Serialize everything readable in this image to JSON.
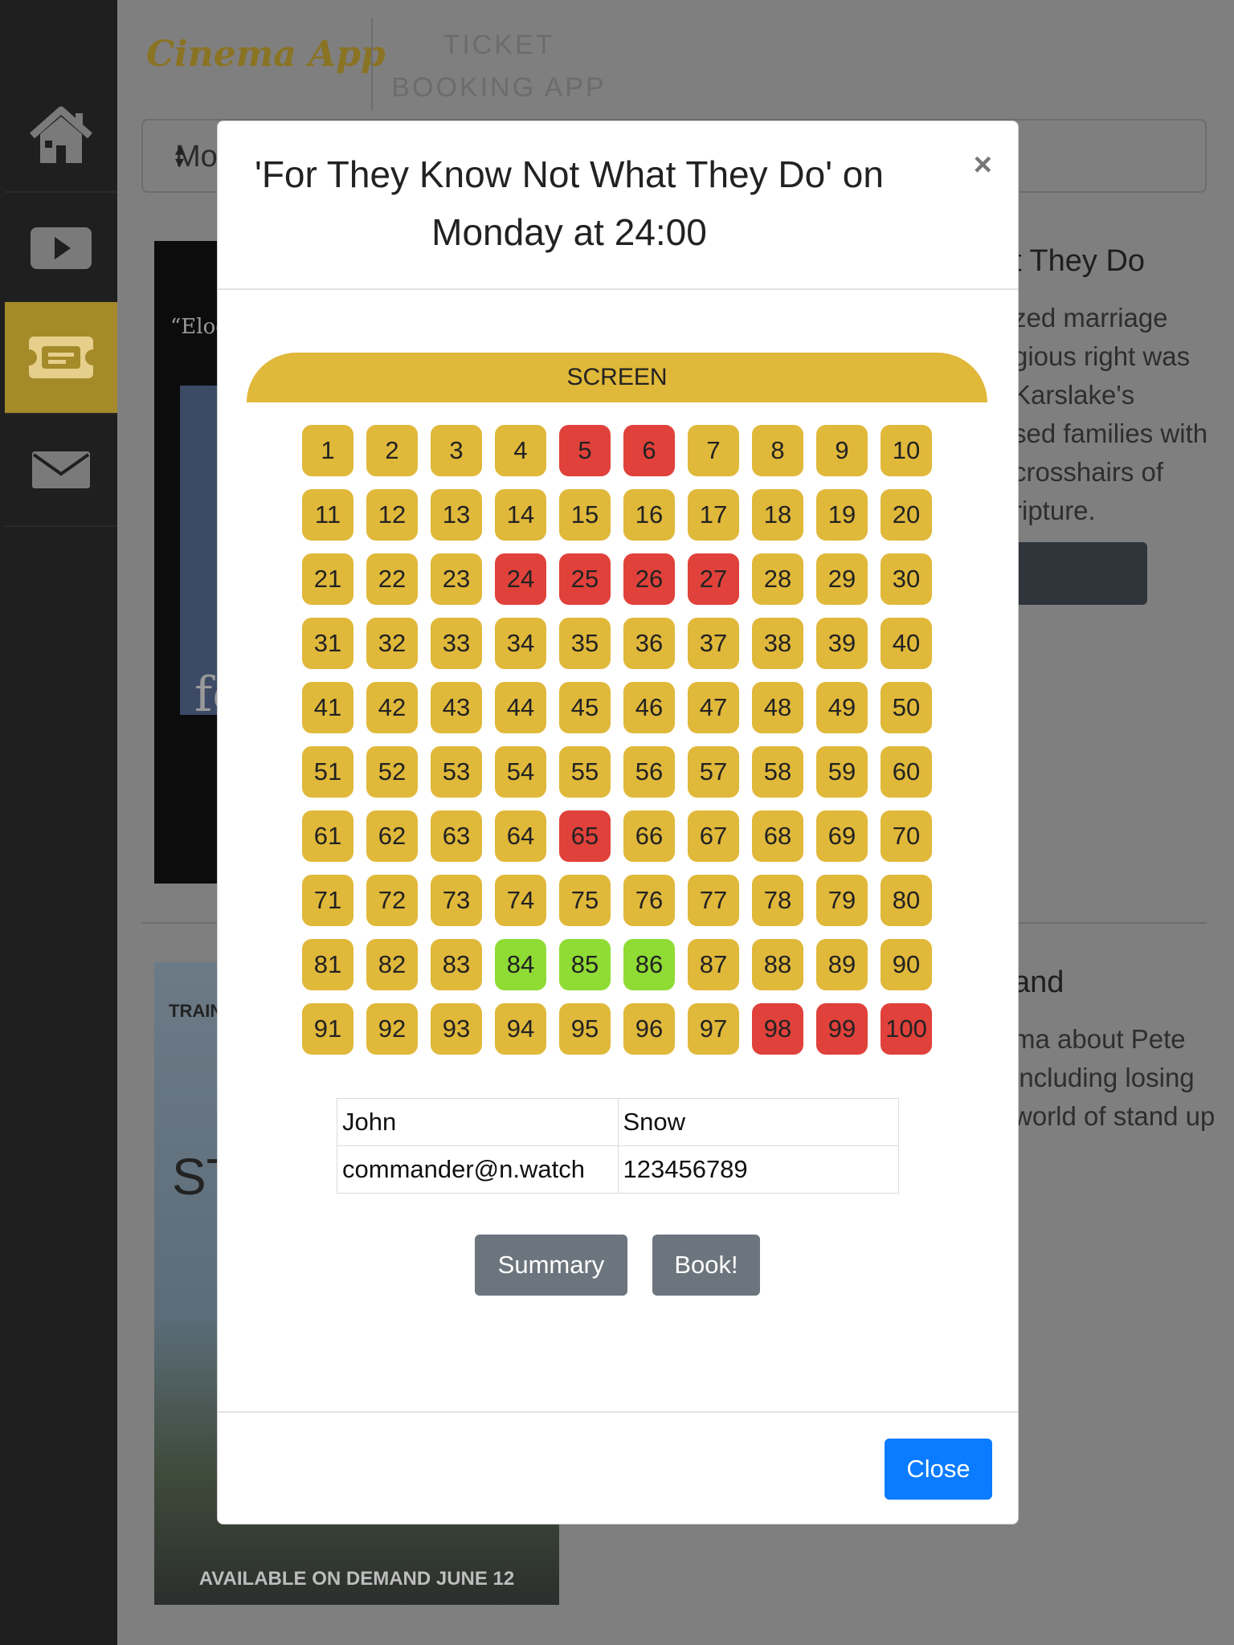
{
  "app": {
    "logo": "Cinema App",
    "tagline": "TICKET BOOKING APP"
  },
  "sidebar": {
    "items": [
      {
        "icon": "home-icon",
        "active": false
      },
      {
        "icon": "play-icon",
        "active": false
      },
      {
        "icon": "ticket-icon",
        "active": true
      },
      {
        "icon": "mail-icon",
        "active": false
      }
    ]
  },
  "background": {
    "select_value": "Mo",
    "movie1": {
      "title_fragment": "t They Do",
      "desc_lines": [
        "zed marriage",
        "gious right was",
        "Karslake's",
        "sed families with",
        "crosshairs of",
        "ripture."
      ],
      "poster_quote": "“Eloq",
      "poster_text": "fo"
    },
    "movie2": {
      "title_fragment": "and",
      "desc_lines": [
        "ma about Pete",
        "including losing",
        "world of stand up"
      ],
      "poster_top": "TRAIN",
      "poster_title": "ST",
      "poster_bottom": "AVAILABLE ON DEMAND JUNE 12"
    }
  },
  "modal": {
    "title": "'For They Know Not What They Do' on Monday at 24:00",
    "close_symbol": "×",
    "screen_label": "SCREEN",
    "seats": {
      "count": 100,
      "booked": [
        5,
        6,
        24,
        25,
        26,
        27,
        65,
        98,
        99,
        100
      ],
      "selected": [
        84,
        85,
        86
      ]
    },
    "form": {
      "first_name": "John",
      "last_name": "Snow",
      "email": "commander@n.watch",
      "phone": "123456789"
    },
    "summary_label": "Summary",
    "book_label": "Book!",
    "close_label": "Close"
  },
  "colors": {
    "seat_available": "#e0b83a",
    "seat_booked": "#e0413a",
    "seat_selected": "#8fdc34",
    "primary": "#0b7bff",
    "secondary": "#6c757d"
  }
}
